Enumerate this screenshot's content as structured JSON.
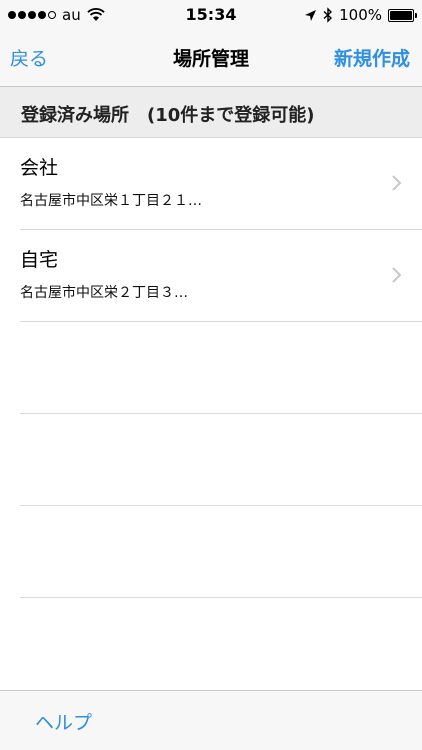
{
  "status_bar": {
    "carrier": "au",
    "time": "15:34",
    "battery": "100%",
    "battery_level": 1.0
  },
  "nav": {
    "back_label": "戻る",
    "title": "場所管理",
    "action_label": "新規作成"
  },
  "section": {
    "header": "登録済み場所　(10件まで登録可能)"
  },
  "places": [
    {
      "name": "会社",
      "address": "名古屋市中区栄１丁目２１…"
    },
    {
      "name": "自宅",
      "address": "名古屋市中区栄２丁目３…"
    }
  ],
  "toolbar": {
    "help_label": "ヘルプ"
  },
  "colors": {
    "accent": "#2f8fe0",
    "bar_background": "#f7f7f7",
    "section_background": "#ededed"
  },
  "icons": {
    "location": "location-arrow-icon",
    "bluetooth": "bluetooth-icon",
    "wifi": "wifi-icon",
    "battery": "battery-icon",
    "disclosure": "chevron-right-icon"
  }
}
